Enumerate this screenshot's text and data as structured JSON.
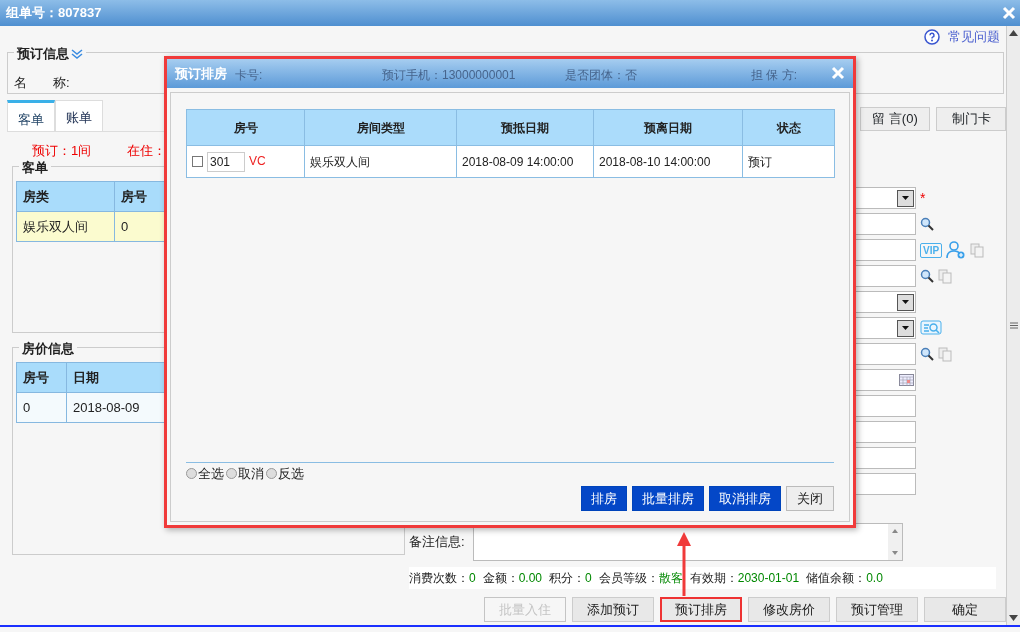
{
  "window": {
    "title": "组单号：807837"
  },
  "help_link": "常见问题",
  "booking_info": {
    "title": "预订信息",
    "name_label": "名　　称:"
  },
  "tabs": [
    {
      "label": "客单",
      "selected": true
    },
    {
      "label": "账单",
      "selected": false
    }
  ],
  "summary": [
    "预订：1间",
    "在住："
  ],
  "guest_list": {
    "title": "客单",
    "columns": [
      "房类",
      "房号"
    ],
    "rows": [
      {
        "cells": [
          "娱乐双人间",
          "0"
        ],
        "selected": true
      }
    ]
  },
  "rate_info": {
    "title": "房价信息",
    "columns": [
      "房号",
      "日期"
    ],
    "rows": [
      {
        "cells": [
          "0",
          "2018-08-09"
        ],
        "selected": false
      }
    ]
  },
  "side_buttons": [
    "留 言(0)",
    "制门卡"
  ],
  "form_fields": [
    {
      "kind": "select",
      "required": true,
      "required_mark": "*"
    },
    {
      "kind": "input",
      "required": false,
      "icons": [
        {
          "kind": "search"
        }
      ]
    },
    {
      "kind": "input",
      "required": false,
      "icons": [
        {
          "kind": "vip",
          "text": "VIP"
        },
        {
          "kind": "user-add"
        },
        {
          "kind": "copy"
        }
      ]
    },
    {
      "kind": "input",
      "required": false,
      "icons": [
        {
          "kind": "search"
        },
        {
          "kind": "copy"
        }
      ]
    },
    {
      "kind": "select",
      "required": false
    },
    {
      "kind": "select",
      "required": false,
      "icons": [
        {
          "kind": "list-search"
        }
      ]
    },
    {
      "kind": "input",
      "required": false,
      "icons": [
        {
          "kind": "search"
        },
        {
          "kind": "copy"
        }
      ]
    },
    {
      "kind": "date",
      "required": false
    },
    {
      "kind": "input",
      "required": false
    },
    {
      "kind": "input",
      "required": false
    },
    {
      "kind": "input",
      "required": false
    },
    {
      "kind": "input",
      "required": false
    }
  ],
  "remark": {
    "label": "备注信息:"
  },
  "member_stats": [
    {
      "label": "消费次数：",
      "value": "0"
    },
    {
      "label": "金额：",
      "value": "0.00"
    },
    {
      "label": "积分：",
      "value": "0"
    },
    {
      "label": "会员等级：",
      "value": "散客"
    },
    {
      "label": "有效期：",
      "value": "2030-01-01"
    },
    {
      "label": "储值余额：",
      "value": "0.0"
    }
  ],
  "actions": [
    {
      "label": "批量入住",
      "disabled": true,
      "highlighted": false
    },
    {
      "label": "添加预订",
      "disabled": false,
      "highlighted": false
    },
    {
      "label": "预订排房",
      "disabled": false,
      "highlighted": true
    },
    {
      "label": "修改房价",
      "disabled": false,
      "highlighted": false
    },
    {
      "label": "预订管理",
      "disabled": false,
      "highlighted": false
    },
    {
      "label": "确定",
      "disabled": false,
      "highlighted": false
    }
  ],
  "dialog": {
    "title": "预订排房",
    "header_behind": [
      "卡号:",
      "预订手机：13000000001",
      "是否团体：否",
      "担 保 方:"
    ],
    "columns": [
      "房号",
      "房间类型",
      "预抵日期",
      "预离日期",
      "状态"
    ],
    "rows": [
      {
        "checked": false,
        "room_status": "VC",
        "cells": [
          "301",
          "娱乐双人间",
          "2018-08-09 14:00:00",
          "2018-08-10 14:00:00",
          "预订"
        ]
      }
    ],
    "select_options": [
      {
        "label": "全选",
        "selected": false
      },
      {
        "label": "取消",
        "selected": false
      },
      {
        "label": "反选",
        "selected": false
      }
    ],
    "buttons": [
      {
        "label": "排房",
        "kind": "primary"
      },
      {
        "label": "批量排房",
        "kind": "primary"
      },
      {
        "label": "取消排房",
        "kind": "primary"
      },
      {
        "label": "关闭",
        "kind": "secondary"
      }
    ]
  }
}
